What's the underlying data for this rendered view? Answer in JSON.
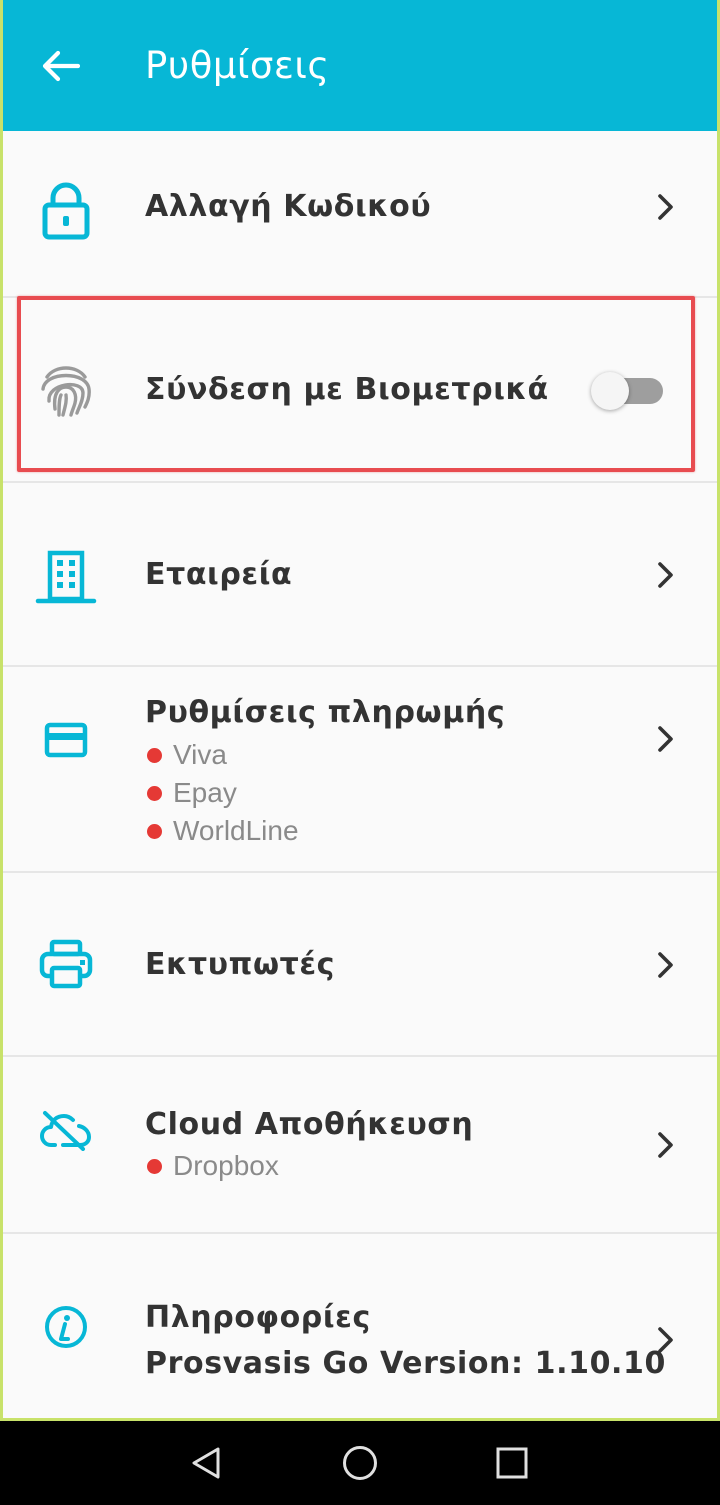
{
  "appbar": {
    "title": "Ρυθμίσεις",
    "back_icon": "arrow-left-icon"
  },
  "settings": {
    "change_password": {
      "label": "Αλλαγή Κωδικού",
      "icon": "lock-icon"
    },
    "biometrics": {
      "label": "Σύνδεση με Βιομετρικά",
      "icon": "fingerprint-icon",
      "enabled": false
    },
    "company": {
      "label": "Εταιρεία",
      "icon": "building-icon"
    },
    "payment": {
      "label": "Ρυθμίσεις πληρωμής",
      "icon": "credit-card-icon",
      "providers": [
        "Viva",
        "Epay",
        "WorldLine"
      ]
    },
    "printers": {
      "label": "Εκτυπωτές",
      "icon": "printer-icon"
    },
    "cloud": {
      "label": "Cloud Αποθήκευση",
      "icon": "cloud-off-icon",
      "providers": [
        "Dropbox"
      ]
    },
    "info": {
      "label": "Πληροφορίες",
      "version": "Prosvasis Go Version: 1.10.10",
      "icon": "info-icon"
    }
  },
  "colors": {
    "accent": "#07b7d6",
    "status_dot": "#e53935",
    "highlight_box": "#e84c50",
    "text": "#333333",
    "subtext": "#8a8a8a"
  },
  "system_nav": {
    "back": "nav-back-icon",
    "home": "nav-home-icon",
    "recents": "nav-recents-icon"
  }
}
